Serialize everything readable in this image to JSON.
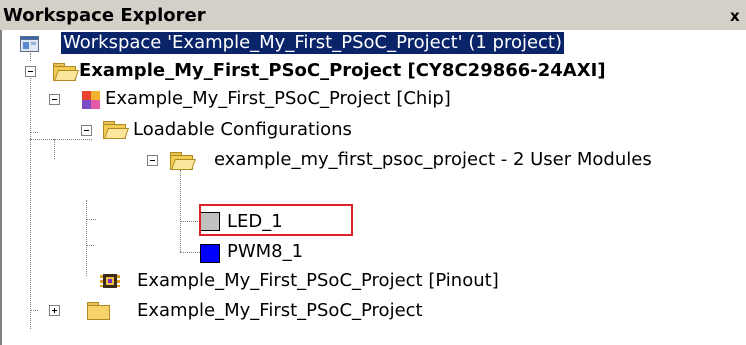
{
  "panel": {
    "title": "Workspace Explorer",
    "close_glyph": "x"
  },
  "tree": {
    "workspace_label": "Workspace 'Example_My_First_PSoC_Project' (1 project)",
    "project_label": "Example_My_First_PSoC_Project [CY8C29866-24AXI]",
    "chip_label": "Example_My_First_PSoC_Project [Chip]",
    "loadable_label": "Loadable Configurations",
    "config_label": "example_my_first_psoc_project - 2 User Modules",
    "led_label": "LED_1",
    "pwm_label": "PWM8_1",
    "pinout_label": "Example_My_First_PSoC_Project [Pinout]",
    "files_label": "Example_My_First_PSoC_Project"
  },
  "colors": {
    "selection": "#0a246a",
    "led_swatch": "#c0c0c0",
    "pwm_swatch": "#0000ff",
    "highlight": "#e0202a"
  },
  "icons": {
    "workspace": "workspace-icon",
    "project": "open-folder-icon",
    "chip": "chip-icon",
    "loadable": "open-folder-icon",
    "config": "open-folder-icon",
    "led": "user-module-swatch-icon",
    "pwm": "user-module-swatch-icon",
    "pinout": "pinout-icon",
    "files": "folder-icon"
  }
}
